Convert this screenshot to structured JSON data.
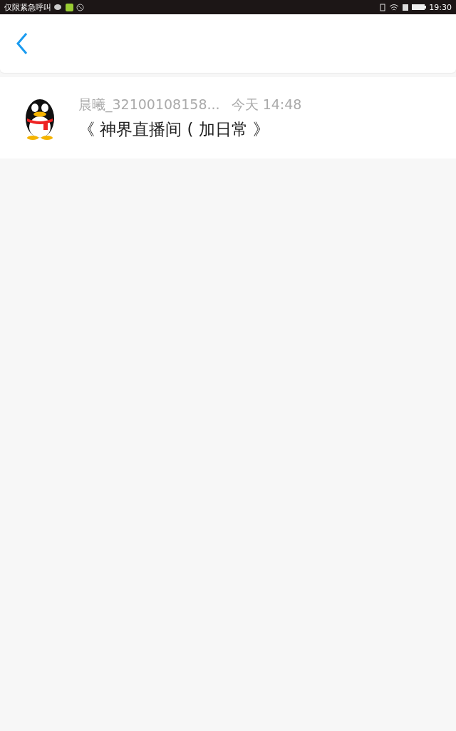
{
  "status_bar": {
    "carrier": "仅限紧急呼叫",
    "time": "19:30"
  },
  "messages": [
    {
      "sender": "晨曦_32100108158...",
      "time": "今天 14:48",
      "text": "《 神界直播间 ( 加日常 》"
    }
  ]
}
